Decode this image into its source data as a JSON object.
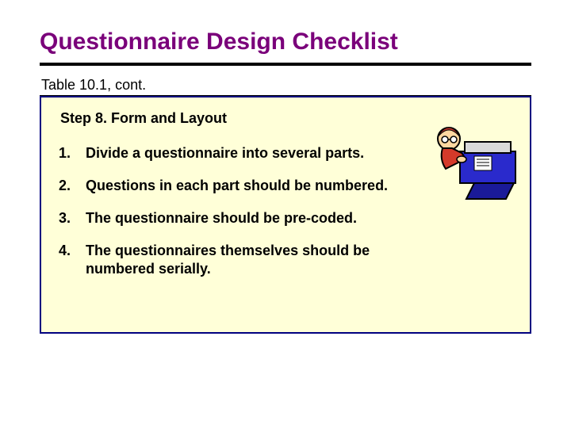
{
  "title": "Questionnaire Design Checklist",
  "table_ref": "Table 10.1, cont.",
  "step_title": "Step 8. Form and Layout",
  "items": [
    "Divide a questionnaire into several parts.",
    "Questions in each part should be numbered.",
    "The questionnaire should be pre-coded.",
    "The questionnaires themselves should be numbered serially."
  ]
}
